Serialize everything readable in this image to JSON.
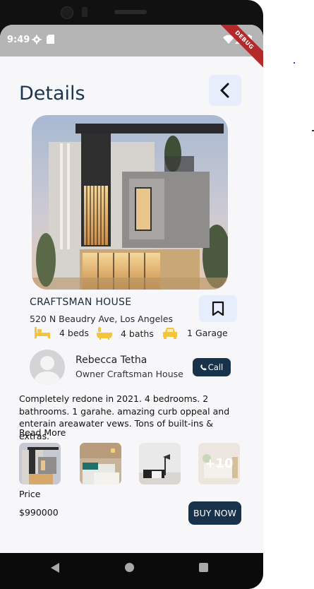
{
  "status": {
    "time": "9:49",
    "debug_banner": "DEBUG"
  },
  "header": {
    "title": "Details"
  },
  "property": {
    "name": "CRAFTSMAN HOUSE",
    "address": "520 N Beaudry Ave, Los Angeles",
    "features": [
      {
        "icon": "bed-icon",
        "label": "4 beds"
      },
      {
        "icon": "bathtub-icon",
        "label": "4 baths"
      },
      {
        "icon": "car-icon",
        "label": "1 Garage"
      }
    ]
  },
  "owner": {
    "name": "Rebecca Tetha",
    "role": "Owner Craftsman House",
    "call_label": "Call"
  },
  "description": {
    "text": "Completely redone in 2021. 4 bedrooms. 2 bathrooms. 1 garahe. amazing curb oppeal and enterain areawater vews. Tons of built-ins & extras.",
    "read_more": "Read More"
  },
  "gallery": {
    "more_label": "+10"
  },
  "price": {
    "label": "Price",
    "value": "$990000",
    "buy_label": "BUY NOW"
  },
  "colors": {
    "accent": "#17324a",
    "feature_icon": "#f2c53d",
    "button_bg": "#e6eefb"
  }
}
